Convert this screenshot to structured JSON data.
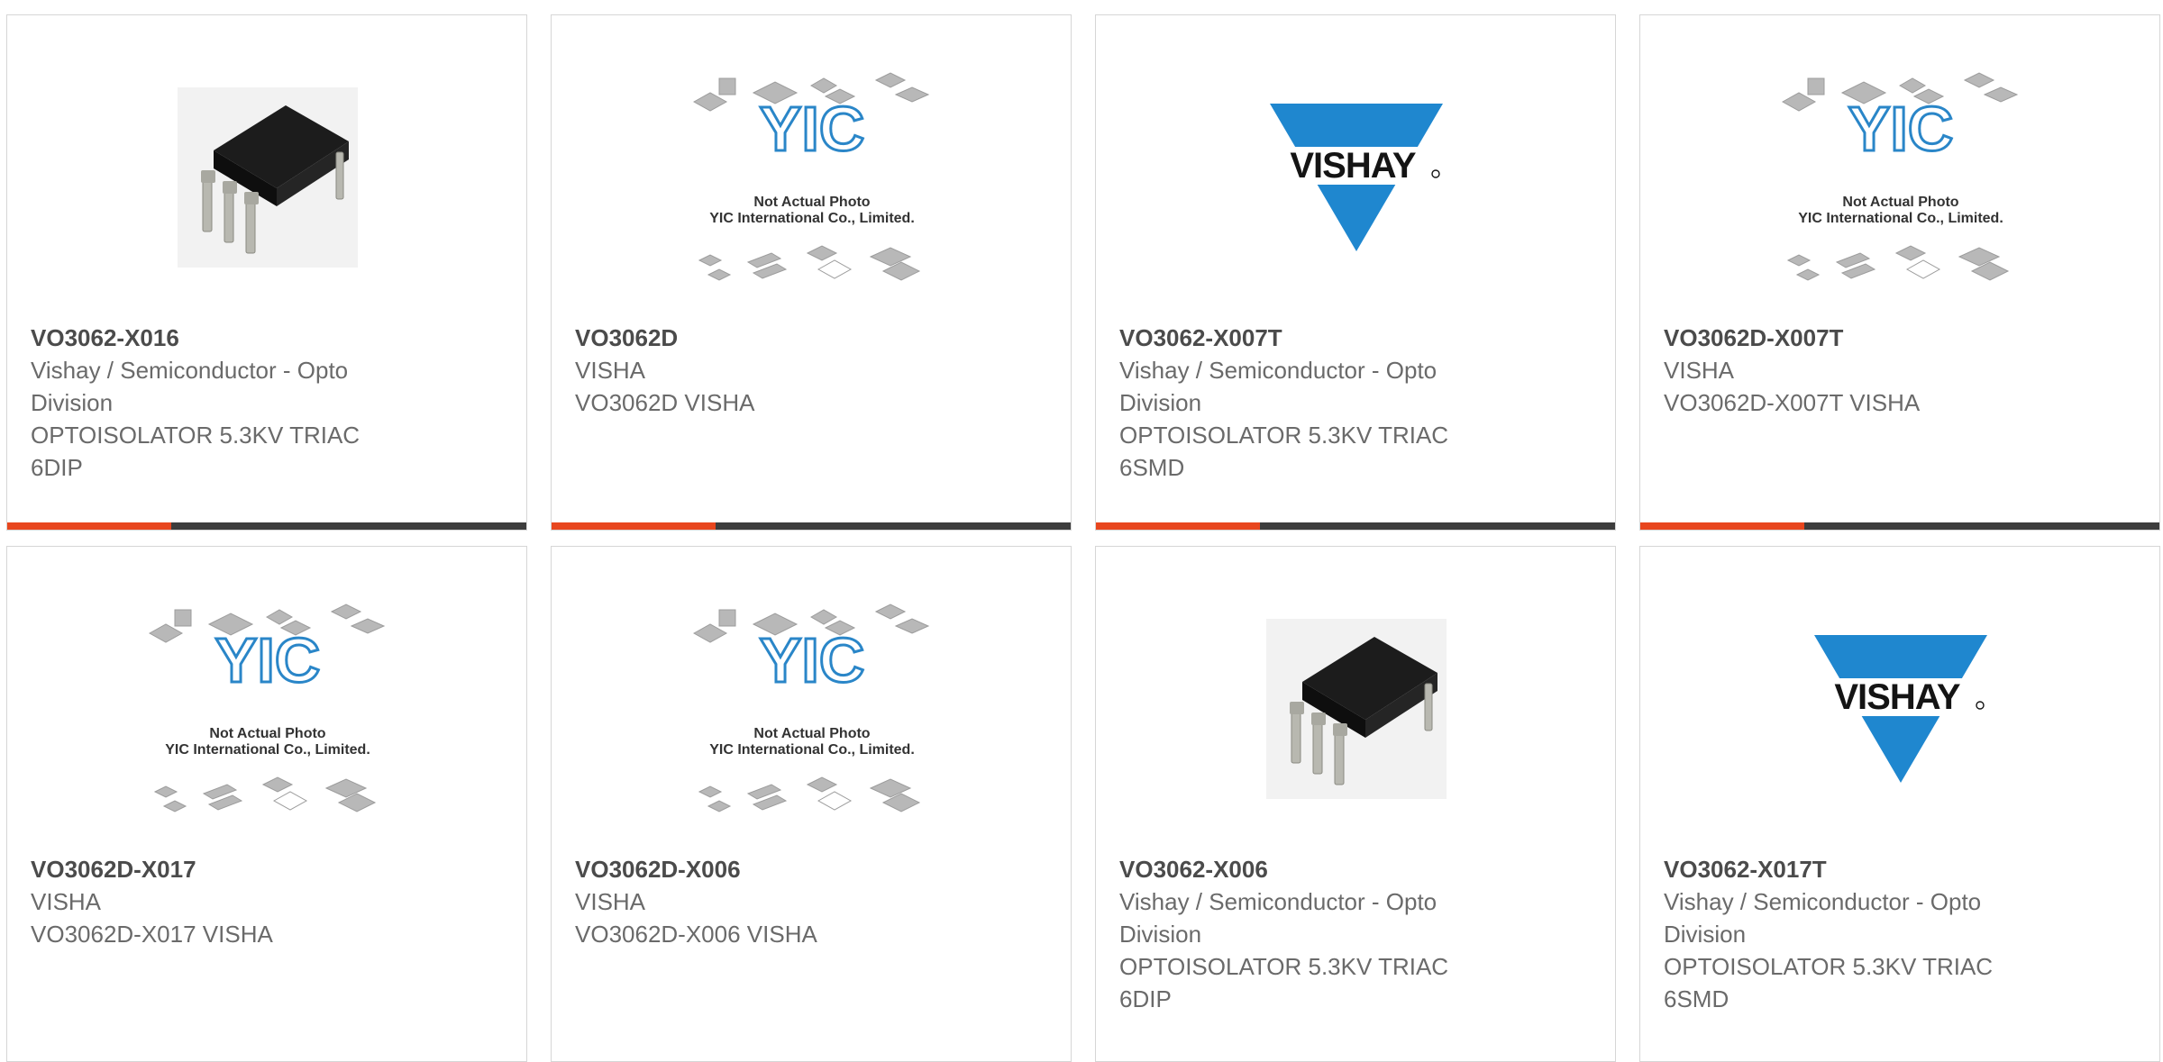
{
  "colors": {
    "accent": "#e8461e",
    "bar": "#3d3d3d",
    "vishay_blue": "#1f87cf",
    "yic_blue": "#2a86c8"
  },
  "products": [
    {
      "part": "VO3062-X016",
      "image": "dip6-chip-photo",
      "lines": [
        "Vishay / Semiconductor - Opto",
        "Division",
        "OPTOISOLATOR 5.3KV TRIAC",
        "6DIP"
      ]
    },
    {
      "part": "VO3062D",
      "image": "yic-placeholder",
      "lines": [
        "VISHA",
        "VO3062D VISHA"
      ]
    },
    {
      "part": "VO3062-X007T",
      "image": "vishay-logo",
      "lines": [
        "Vishay / Semiconductor - Opto",
        "Division",
        "OPTOISOLATOR 5.3KV TRIAC",
        "6SMD"
      ]
    },
    {
      "part": "VO3062D-X007T",
      "image": "yic-placeholder",
      "lines": [
        "VISHA",
        "VO3062D-X007T VISHA"
      ]
    },
    {
      "part": "VO3062D-X017",
      "image": "yic-placeholder",
      "lines": [
        "VISHA",
        "VO3062D-X017 VISHA"
      ]
    },
    {
      "part": "VO3062D-X006",
      "image": "yic-placeholder",
      "lines": [
        "VISHA",
        "VO3062D-X006 VISHA"
      ]
    },
    {
      "part": "VO3062-X006",
      "image": "dip6-chip-photo",
      "lines": [
        "Vishay / Semiconductor - Opto",
        "Division",
        "OPTOISOLATOR 5.3KV TRIAC",
        "6DIP"
      ]
    },
    {
      "part": "VO3062-X017T",
      "image": "vishay-logo",
      "lines": [
        "Vishay / Semiconductor - Opto",
        "Division",
        "OPTOISOLATOR 5.3KV TRIAC",
        "6SMD"
      ]
    }
  ],
  "yic_placeholder": {
    "caption1": "Not Actual Photo",
    "caption2": "YIC International Co., Limited.",
    "logo_text": "YIC"
  },
  "vishay_logo": {
    "text": "VISHAY"
  }
}
